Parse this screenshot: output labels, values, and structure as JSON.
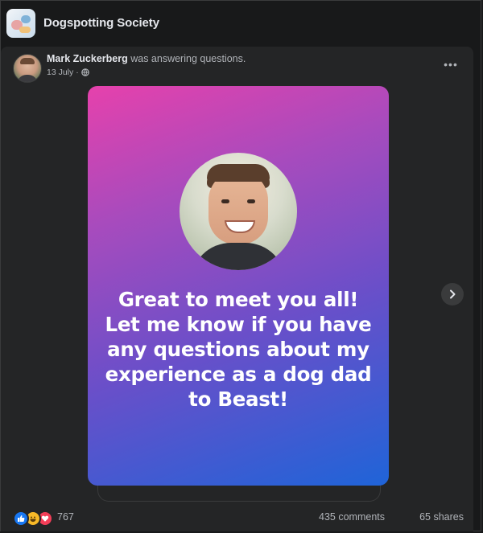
{
  "group": {
    "name": "Dogspotting Society"
  },
  "post": {
    "author": "Mark Zuckerberg",
    "action": "was answering questions.",
    "date": "13 July",
    "separator": "·",
    "more_label": "•••",
    "quote": "Great to meet you all! Let me know if you have any questions about my experience as a dog dad to Beast!",
    "gradient_colors": [
      "#e641ac",
      "#1f64d8"
    ]
  },
  "footer": {
    "reaction_count": "767",
    "reactions": [
      "like-icon",
      "haha-icon",
      "love-icon"
    ],
    "comments": "435 comments",
    "shares": "65 shares"
  }
}
